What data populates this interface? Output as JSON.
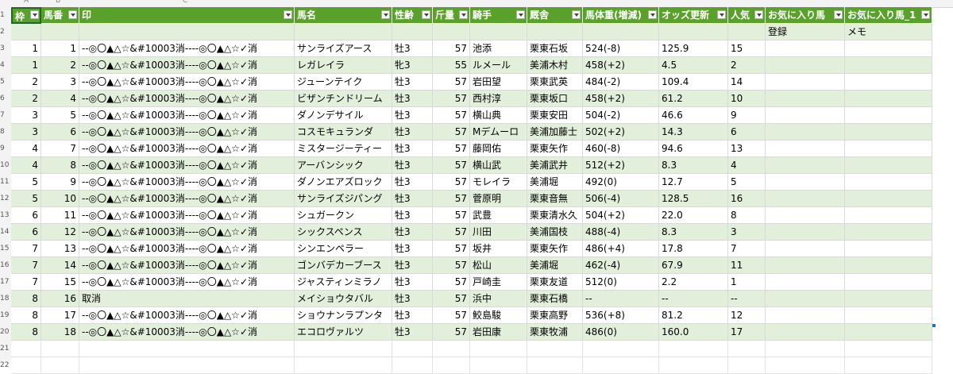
{
  "column_letters": [
    "A",
    "B",
    "C",
    "",
    "",
    "",
    "",
    "",
    "",
    "",
    "",
    "",
    "",
    "",
    "",
    "",
    "",
    "",
    ""
  ],
  "row_numbers": [
    "1",
    "2",
    "3",
    "4",
    "5",
    "6",
    "7",
    "8",
    "9",
    "10",
    "11",
    "12",
    "13",
    "14",
    "15",
    "16",
    "17",
    "18",
    "19",
    "20",
    "21",
    "22"
  ],
  "headers": [
    "枠",
    "馬番",
    "印",
    "馬名",
    "性齢",
    "斤量",
    "騎手",
    "厩舎",
    "馬体重(増減)",
    "オッズ更新",
    "人気",
    "お気に入り馬",
    "お気に入り馬_1"
  ],
  "subheader": [
    "",
    "",
    "",
    "",
    "",
    "",
    "",
    "",
    "",
    "",
    "",
    "登録",
    "メモ"
  ],
  "rows": [
    [
      "1",
      "1",
      "--◎〇▲△☆&#10003消----◎〇▲△☆✓消",
      "サンライズアース",
      "牡3",
      "57",
      "池添",
      "栗東石坂",
      "524(-8)",
      "125.9",
      "15",
      "",
      ""
    ],
    [
      "1",
      "2",
      "--◎〇▲△☆&#10003消----◎〇▲△☆✓消",
      "レガレイラ",
      "牝3",
      "55",
      "ルメール",
      "美浦木村",
      "458(+2)",
      "4.5",
      "2",
      "",
      ""
    ],
    [
      "2",
      "3",
      "--◎〇▲△☆&#10003消----◎〇▲△☆✓消",
      "ジューンテイク",
      "牡3",
      "57",
      "岩田望",
      "栗東武英",
      "484(-2)",
      "109.4",
      "14",
      "",
      ""
    ],
    [
      "2",
      "4",
      "--◎〇▲△☆&#10003消----◎〇▲△☆✓消",
      "ビザンチンドリーム",
      "牡3",
      "57",
      "西村淳",
      "栗東坂口",
      "458(+2)",
      "61.2",
      "10",
      "",
      ""
    ],
    [
      "3",
      "5",
      "--◎〇▲△☆&#10003消----◎〇▲△☆✓消",
      "ダノンデサイル",
      "牡3",
      "57",
      "横山典",
      "栗東安田",
      "504(-2)",
      "46.6",
      "9",
      "",
      ""
    ],
    [
      "3",
      "6",
      "--◎〇▲△☆&#10003消----◎〇▲△☆✓消",
      "コスモキュランダ",
      "牡3",
      "57",
      "Mデムーロ",
      "美浦加藤士",
      "502(+2)",
      "14.3",
      "6",
      "",
      ""
    ],
    [
      "4",
      "7",
      "--◎〇▲△☆&#10003消----◎〇▲△☆✓消",
      "ミスタージーティー",
      "牡3",
      "57",
      "藤岡佑",
      "栗東矢作",
      "460(-8)",
      "94.6",
      "13",
      "",
      ""
    ],
    [
      "4",
      "8",
      "--◎〇▲△☆&#10003消----◎〇▲△☆✓消",
      "アーバンシック",
      "牡3",
      "57",
      "横山武",
      "美浦武井",
      "512(+2)",
      "8.3",
      "4",
      "",
      ""
    ],
    [
      "5",
      "9",
      "--◎〇▲△☆&#10003消----◎〇▲△☆✓消",
      "ダノンエアズロック",
      "牡3",
      "57",
      "モレイラ",
      "美浦堀",
      "492(0)",
      "12.7",
      "5",
      "",
      ""
    ],
    [
      "5",
      "10",
      "--◎〇▲△☆&#10003消----◎〇▲△☆✓消",
      "サンライズジパング",
      "牡3",
      "57",
      "菅原明",
      "栗東音無",
      "506(-4)",
      "128.5",
      "16",
      "",
      ""
    ],
    [
      "6",
      "11",
      "--◎〇▲△☆&#10003消----◎〇▲△☆✓消",
      "シュガークン",
      "牡3",
      "57",
      "武豊",
      "栗東清水久",
      "504(+2)",
      "22.0",
      "8",
      "",
      ""
    ],
    [
      "6",
      "12",
      "--◎〇▲△☆&#10003消----◎〇▲△☆✓消",
      "シックスペンス",
      "牡3",
      "57",
      "川田",
      "美浦国枝",
      "488(-4)",
      "8.3",
      "3",
      "",
      ""
    ],
    [
      "7",
      "13",
      "--◎〇▲△☆&#10003消----◎〇▲△☆✓消",
      "シンエンペラー",
      "牡3",
      "57",
      "坂井",
      "栗東矢作",
      "486(+4)",
      "17.8",
      "7",
      "",
      ""
    ],
    [
      "7",
      "14",
      "--◎〇▲△☆&#10003消----◎〇▲△☆✓消",
      "ゴンバデカーブース",
      "牡3",
      "57",
      "松山",
      "美浦堀",
      "462(-4)",
      "67.9",
      "11",
      "",
      ""
    ],
    [
      "7",
      "15",
      "--◎〇▲△☆&#10003消----◎〇▲△☆✓消",
      "ジャスティンミラノ",
      "牡3",
      "57",
      "戸崎圭",
      "栗東友道",
      "512(0)",
      "2.2",
      "1",
      "",
      ""
    ],
    [
      "8",
      "16",
      "取消",
      "メイショウタバル",
      "牡3",
      "57",
      "浜中",
      "栗東石橋",
      "--",
      "--",
      "--",
      "",
      ""
    ],
    [
      "8",
      "17",
      "--◎〇▲△☆&#10003消----◎〇▲△☆✓消",
      "ショウナンラプンタ",
      "牡3",
      "57",
      "鮫島駿",
      "栗東高野",
      "536(+8)",
      "81.2",
      "12",
      "",
      ""
    ],
    [
      "8",
      "18",
      "--◎〇▲△☆&#10003消----◎〇▲△☆✓消",
      "エコロヴァルツ",
      "牡3",
      "57",
      "岩田康",
      "栗東牧浦",
      "486(0)",
      "160.0",
      "17",
      "",
      ""
    ]
  ],
  "colors": {
    "header_bg": "#5aa02c",
    "band_bg": "#e2efda"
  }
}
